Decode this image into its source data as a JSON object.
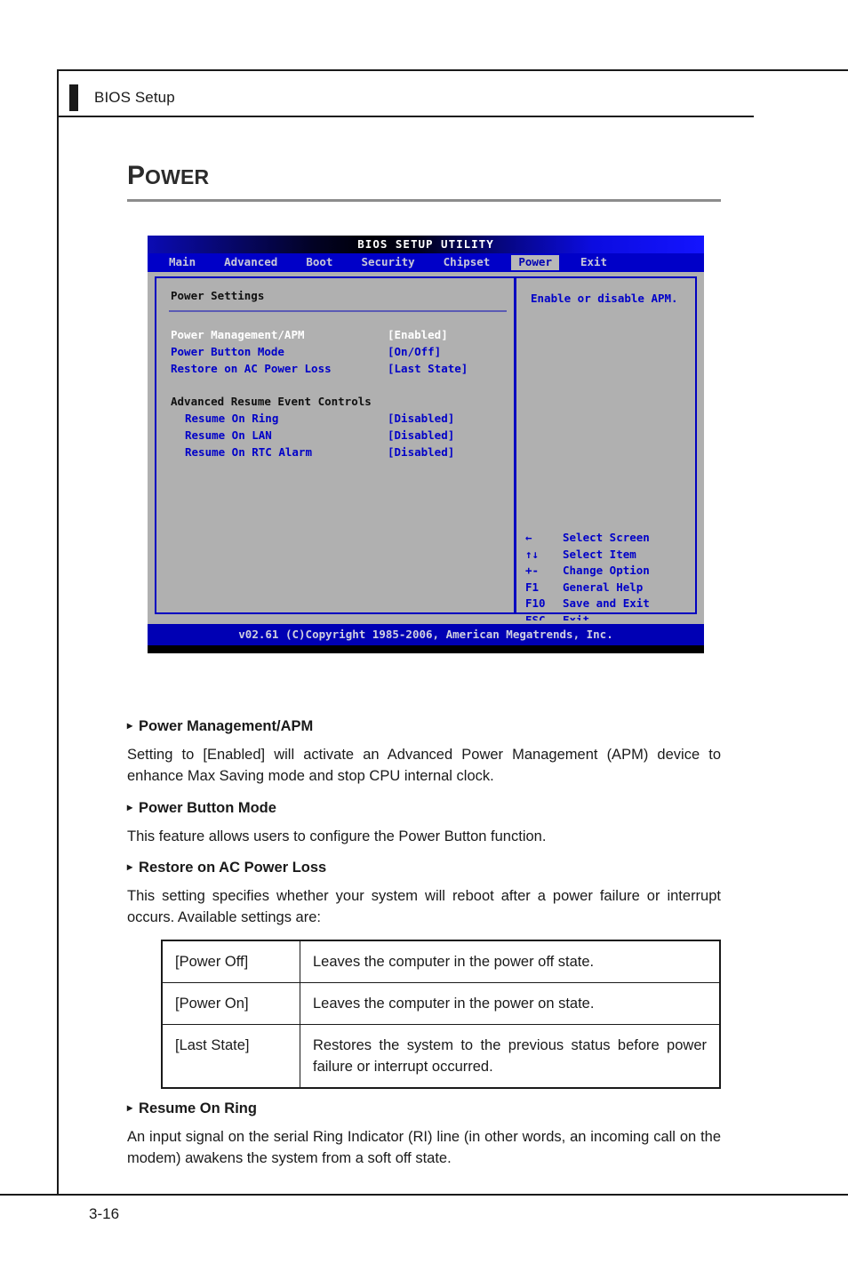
{
  "page": {
    "running_head": "BIOS Setup",
    "section_title_cap": "P",
    "section_title_rest": "OWER",
    "page_number": "3-16"
  },
  "bios": {
    "title": "BIOS SETUP UTILITY",
    "tabs": [
      {
        "label": "Main",
        "active": false
      },
      {
        "label": "Advanced",
        "active": false
      },
      {
        "label": "Boot",
        "active": false
      },
      {
        "label": "Security",
        "active": false
      },
      {
        "label": "Chipset",
        "active": false
      },
      {
        "label": "Power",
        "active": true
      },
      {
        "label": "Exit",
        "active": false
      }
    ],
    "panel_heading": "Power Settings",
    "settings": [
      {
        "name": "Power Management/APM",
        "value": "[Enabled]",
        "selected": true,
        "indent": false,
        "heading": false
      },
      {
        "name": "Power Button Mode",
        "value": "[On/Off]",
        "selected": false,
        "indent": false,
        "heading": false
      },
      {
        "name": "Restore on AC Power Loss",
        "value": "[Last State]",
        "selected": false,
        "indent": false,
        "heading": false
      },
      {
        "name": "Advanced Resume Event Controls",
        "value": "",
        "selected": false,
        "indent": false,
        "heading": true
      },
      {
        "name": "Resume On Ring",
        "value": "[Disabled]",
        "selected": false,
        "indent": true,
        "heading": false
      },
      {
        "name": "Resume On LAN",
        "value": "[Disabled]",
        "selected": false,
        "indent": true,
        "heading": false
      },
      {
        "name": "Resume On RTC Alarm",
        "value": "[Disabled]",
        "selected": false,
        "indent": true,
        "heading": false
      }
    ],
    "help_text": "Enable or disable APM.",
    "key_legend": [
      {
        "key": "←",
        "action": "Select Screen"
      },
      {
        "key": "↑↓",
        "action": "Select Item"
      },
      {
        "key": "+-",
        "action": "Change Option"
      },
      {
        "key": "F1",
        "action": "General Help"
      },
      {
        "key": "F10",
        "action": "Save and Exit"
      },
      {
        "key": "ESC",
        "action": "Exit"
      }
    ],
    "footer": "v02.61 (C)Copyright 1985-2006, American Megatrends, Inc.",
    "colors": {
      "panel_bg": "#b0b0b0",
      "menu_bg": "#0000c8",
      "text_blue": "#0000c8",
      "selected_text": "#ffffff",
      "active_tab_bg": "#b8b8b8"
    }
  },
  "descriptions": [
    {
      "heading": "Power Management/APM",
      "body": "Setting to [Enabled] will activate an Advanced Power Management (APM) device to enhance Max Saving mode and stop CPU internal clock."
    },
    {
      "heading": "Power Button Mode",
      "body": "This feature allows users to configure the Power Button function."
    },
    {
      "heading": "Restore on AC Power Loss",
      "body": "This setting specifies whether your system will reboot after a power failure or interrupt occurs. Available settings are:"
    },
    {
      "heading": "Resume On Ring",
      "body": "An input signal on the serial Ring Indicator (RI) line (in other words, an incoming call on the modem) awakens the system from a soft off state."
    }
  ],
  "options_table": {
    "rows": [
      {
        "key": "[Power Off]",
        "desc": "Leaves the computer in the power off state."
      },
      {
        "key": "[Power On]",
        "desc": "Leaves the computer in the power on state."
      },
      {
        "key": "[Last State]",
        "desc": "Restores the system to the previous status before power failure or interrupt occurred."
      }
    ]
  },
  "icons": {
    "bullet": "▸",
    "head_bar": "head-marker"
  }
}
